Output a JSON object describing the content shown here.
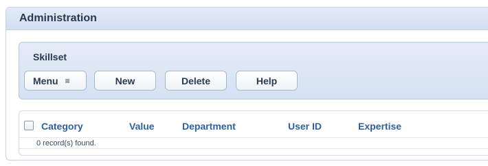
{
  "admin": {
    "title": "Administration"
  },
  "skillset": {
    "title": "Skillset",
    "buttons": {
      "menu": "Menu",
      "new": "New",
      "delete": "Delete",
      "help": "Help"
    }
  },
  "grid": {
    "columns": [
      "Category",
      "Value",
      "Department",
      "User ID",
      "Expertise"
    ],
    "status": "0 record(s) found."
  }
}
